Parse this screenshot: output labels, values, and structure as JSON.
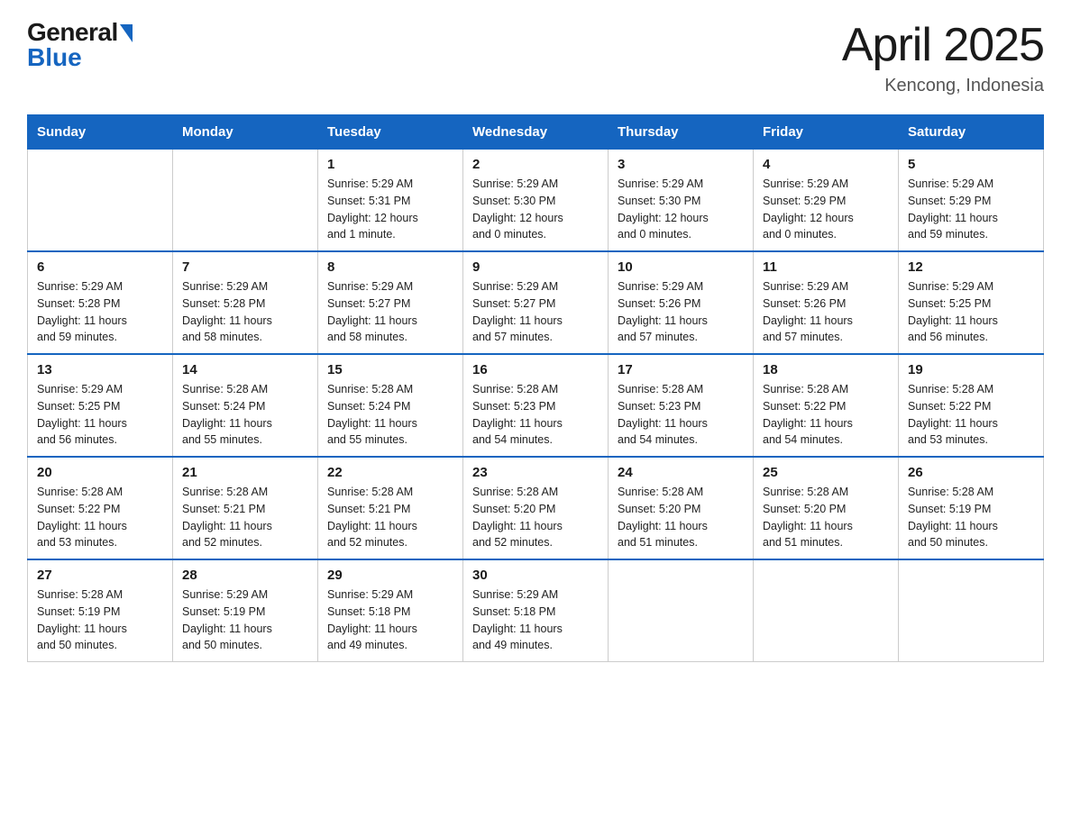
{
  "logo": {
    "general": "General",
    "blue": "Blue"
  },
  "title": {
    "month": "April 2025",
    "location": "Kencong, Indonesia"
  },
  "weekdays": [
    "Sunday",
    "Monday",
    "Tuesday",
    "Wednesday",
    "Thursday",
    "Friday",
    "Saturday"
  ],
  "weeks": [
    [
      {
        "day": "",
        "info": ""
      },
      {
        "day": "",
        "info": ""
      },
      {
        "day": "1",
        "info": "Sunrise: 5:29 AM\nSunset: 5:31 PM\nDaylight: 12 hours\nand 1 minute."
      },
      {
        "day": "2",
        "info": "Sunrise: 5:29 AM\nSunset: 5:30 PM\nDaylight: 12 hours\nand 0 minutes."
      },
      {
        "day": "3",
        "info": "Sunrise: 5:29 AM\nSunset: 5:30 PM\nDaylight: 12 hours\nand 0 minutes."
      },
      {
        "day": "4",
        "info": "Sunrise: 5:29 AM\nSunset: 5:29 PM\nDaylight: 12 hours\nand 0 minutes."
      },
      {
        "day": "5",
        "info": "Sunrise: 5:29 AM\nSunset: 5:29 PM\nDaylight: 11 hours\nand 59 minutes."
      }
    ],
    [
      {
        "day": "6",
        "info": "Sunrise: 5:29 AM\nSunset: 5:28 PM\nDaylight: 11 hours\nand 59 minutes."
      },
      {
        "day": "7",
        "info": "Sunrise: 5:29 AM\nSunset: 5:28 PM\nDaylight: 11 hours\nand 58 minutes."
      },
      {
        "day": "8",
        "info": "Sunrise: 5:29 AM\nSunset: 5:27 PM\nDaylight: 11 hours\nand 58 minutes."
      },
      {
        "day": "9",
        "info": "Sunrise: 5:29 AM\nSunset: 5:27 PM\nDaylight: 11 hours\nand 57 minutes."
      },
      {
        "day": "10",
        "info": "Sunrise: 5:29 AM\nSunset: 5:26 PM\nDaylight: 11 hours\nand 57 minutes."
      },
      {
        "day": "11",
        "info": "Sunrise: 5:29 AM\nSunset: 5:26 PM\nDaylight: 11 hours\nand 57 minutes."
      },
      {
        "day": "12",
        "info": "Sunrise: 5:29 AM\nSunset: 5:25 PM\nDaylight: 11 hours\nand 56 minutes."
      }
    ],
    [
      {
        "day": "13",
        "info": "Sunrise: 5:29 AM\nSunset: 5:25 PM\nDaylight: 11 hours\nand 56 minutes."
      },
      {
        "day": "14",
        "info": "Sunrise: 5:28 AM\nSunset: 5:24 PM\nDaylight: 11 hours\nand 55 minutes."
      },
      {
        "day": "15",
        "info": "Sunrise: 5:28 AM\nSunset: 5:24 PM\nDaylight: 11 hours\nand 55 minutes."
      },
      {
        "day": "16",
        "info": "Sunrise: 5:28 AM\nSunset: 5:23 PM\nDaylight: 11 hours\nand 54 minutes."
      },
      {
        "day": "17",
        "info": "Sunrise: 5:28 AM\nSunset: 5:23 PM\nDaylight: 11 hours\nand 54 minutes."
      },
      {
        "day": "18",
        "info": "Sunrise: 5:28 AM\nSunset: 5:22 PM\nDaylight: 11 hours\nand 54 minutes."
      },
      {
        "day": "19",
        "info": "Sunrise: 5:28 AM\nSunset: 5:22 PM\nDaylight: 11 hours\nand 53 minutes."
      }
    ],
    [
      {
        "day": "20",
        "info": "Sunrise: 5:28 AM\nSunset: 5:22 PM\nDaylight: 11 hours\nand 53 minutes."
      },
      {
        "day": "21",
        "info": "Sunrise: 5:28 AM\nSunset: 5:21 PM\nDaylight: 11 hours\nand 52 minutes."
      },
      {
        "day": "22",
        "info": "Sunrise: 5:28 AM\nSunset: 5:21 PM\nDaylight: 11 hours\nand 52 minutes."
      },
      {
        "day": "23",
        "info": "Sunrise: 5:28 AM\nSunset: 5:20 PM\nDaylight: 11 hours\nand 52 minutes."
      },
      {
        "day": "24",
        "info": "Sunrise: 5:28 AM\nSunset: 5:20 PM\nDaylight: 11 hours\nand 51 minutes."
      },
      {
        "day": "25",
        "info": "Sunrise: 5:28 AM\nSunset: 5:20 PM\nDaylight: 11 hours\nand 51 minutes."
      },
      {
        "day": "26",
        "info": "Sunrise: 5:28 AM\nSunset: 5:19 PM\nDaylight: 11 hours\nand 50 minutes."
      }
    ],
    [
      {
        "day": "27",
        "info": "Sunrise: 5:28 AM\nSunset: 5:19 PM\nDaylight: 11 hours\nand 50 minutes."
      },
      {
        "day": "28",
        "info": "Sunrise: 5:29 AM\nSunset: 5:19 PM\nDaylight: 11 hours\nand 50 minutes."
      },
      {
        "day": "29",
        "info": "Sunrise: 5:29 AM\nSunset: 5:18 PM\nDaylight: 11 hours\nand 49 minutes."
      },
      {
        "day": "30",
        "info": "Sunrise: 5:29 AM\nSunset: 5:18 PM\nDaylight: 11 hours\nand 49 minutes."
      },
      {
        "day": "",
        "info": ""
      },
      {
        "day": "",
        "info": ""
      },
      {
        "day": "",
        "info": ""
      }
    ]
  ]
}
